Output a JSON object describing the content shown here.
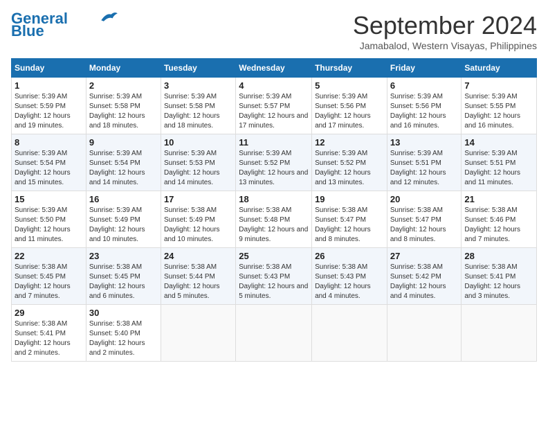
{
  "header": {
    "logo_general": "General",
    "logo_blue": "Blue",
    "month_title": "September 2024",
    "subtitle": "Jamabalod, Western Visayas, Philippines"
  },
  "weekdays": [
    "Sunday",
    "Monday",
    "Tuesday",
    "Wednesday",
    "Thursday",
    "Friday",
    "Saturday"
  ],
  "weeks": [
    [
      {
        "day": 1,
        "sunrise": "5:39 AM",
        "sunset": "5:59 PM",
        "daylight": "12 hours and 19 minutes."
      },
      {
        "day": 2,
        "sunrise": "5:39 AM",
        "sunset": "5:58 PM",
        "daylight": "12 hours and 18 minutes."
      },
      {
        "day": 3,
        "sunrise": "5:39 AM",
        "sunset": "5:58 PM",
        "daylight": "12 hours and 18 minutes."
      },
      {
        "day": 4,
        "sunrise": "5:39 AM",
        "sunset": "5:57 PM",
        "daylight": "12 hours and 17 minutes."
      },
      {
        "day": 5,
        "sunrise": "5:39 AM",
        "sunset": "5:56 PM",
        "daylight": "12 hours and 17 minutes."
      },
      {
        "day": 6,
        "sunrise": "5:39 AM",
        "sunset": "5:56 PM",
        "daylight": "12 hours and 16 minutes."
      },
      {
        "day": 7,
        "sunrise": "5:39 AM",
        "sunset": "5:55 PM",
        "daylight": "12 hours and 16 minutes."
      }
    ],
    [
      {
        "day": 8,
        "sunrise": "5:39 AM",
        "sunset": "5:54 PM",
        "daylight": "12 hours and 15 minutes."
      },
      {
        "day": 9,
        "sunrise": "5:39 AM",
        "sunset": "5:54 PM",
        "daylight": "12 hours and 14 minutes."
      },
      {
        "day": 10,
        "sunrise": "5:39 AM",
        "sunset": "5:53 PM",
        "daylight": "12 hours and 14 minutes."
      },
      {
        "day": 11,
        "sunrise": "5:39 AM",
        "sunset": "5:52 PM",
        "daylight": "12 hours and 13 minutes."
      },
      {
        "day": 12,
        "sunrise": "5:39 AM",
        "sunset": "5:52 PM",
        "daylight": "12 hours and 13 minutes."
      },
      {
        "day": 13,
        "sunrise": "5:39 AM",
        "sunset": "5:51 PM",
        "daylight": "12 hours and 12 minutes."
      },
      {
        "day": 14,
        "sunrise": "5:39 AM",
        "sunset": "5:51 PM",
        "daylight": "12 hours and 11 minutes."
      }
    ],
    [
      {
        "day": 15,
        "sunrise": "5:39 AM",
        "sunset": "5:50 PM",
        "daylight": "12 hours and 11 minutes."
      },
      {
        "day": 16,
        "sunrise": "5:39 AM",
        "sunset": "5:49 PM",
        "daylight": "12 hours and 10 minutes."
      },
      {
        "day": 17,
        "sunrise": "5:38 AM",
        "sunset": "5:49 PM",
        "daylight": "12 hours and 10 minutes."
      },
      {
        "day": 18,
        "sunrise": "5:38 AM",
        "sunset": "5:48 PM",
        "daylight": "12 hours and 9 minutes."
      },
      {
        "day": 19,
        "sunrise": "5:38 AM",
        "sunset": "5:47 PM",
        "daylight": "12 hours and 8 minutes."
      },
      {
        "day": 20,
        "sunrise": "5:38 AM",
        "sunset": "5:47 PM",
        "daylight": "12 hours and 8 minutes."
      },
      {
        "day": 21,
        "sunrise": "5:38 AM",
        "sunset": "5:46 PM",
        "daylight": "12 hours and 7 minutes."
      }
    ],
    [
      {
        "day": 22,
        "sunrise": "5:38 AM",
        "sunset": "5:45 PM",
        "daylight": "12 hours and 7 minutes."
      },
      {
        "day": 23,
        "sunrise": "5:38 AM",
        "sunset": "5:45 PM",
        "daylight": "12 hours and 6 minutes."
      },
      {
        "day": 24,
        "sunrise": "5:38 AM",
        "sunset": "5:44 PM",
        "daylight": "12 hours and 5 minutes."
      },
      {
        "day": 25,
        "sunrise": "5:38 AM",
        "sunset": "5:43 PM",
        "daylight": "12 hours and 5 minutes."
      },
      {
        "day": 26,
        "sunrise": "5:38 AM",
        "sunset": "5:43 PM",
        "daylight": "12 hours and 4 minutes."
      },
      {
        "day": 27,
        "sunrise": "5:38 AM",
        "sunset": "5:42 PM",
        "daylight": "12 hours and 4 minutes."
      },
      {
        "day": 28,
        "sunrise": "5:38 AM",
        "sunset": "5:41 PM",
        "daylight": "12 hours and 3 minutes."
      }
    ],
    [
      {
        "day": 29,
        "sunrise": "5:38 AM",
        "sunset": "5:41 PM",
        "daylight": "12 hours and 2 minutes."
      },
      {
        "day": 30,
        "sunrise": "5:38 AM",
        "sunset": "5:40 PM",
        "daylight": "12 hours and 2 minutes."
      },
      null,
      null,
      null,
      null,
      null
    ]
  ]
}
